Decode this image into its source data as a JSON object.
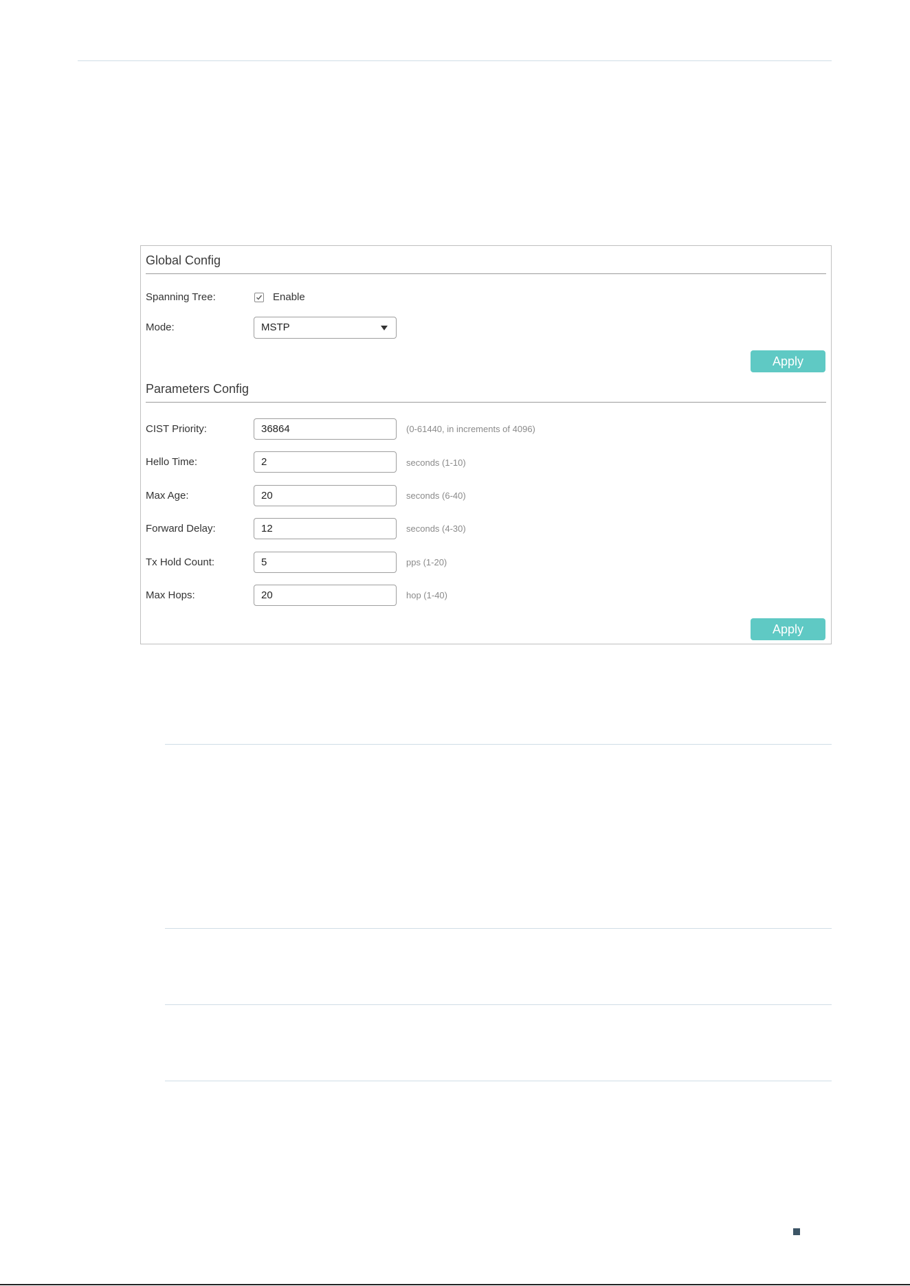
{
  "panel": {
    "global_config": {
      "title": "Global Config",
      "spanning_tree_label": "Spanning Tree:",
      "enable_label": "Enable",
      "enable_checked": true,
      "mode_label": "Mode:",
      "mode_value": "MSTP",
      "apply_label": "Apply"
    },
    "parameters_config": {
      "title": "Parameters Config",
      "rows": [
        {
          "label": "CIST Priority:",
          "value": "36864",
          "hint": "(0-61440, in increments of 4096)"
        },
        {
          "label": "Hello Time:",
          "value": "2",
          "hint": "seconds (1-10)"
        },
        {
          "label": "Max Age:",
          "value": "20",
          "hint": "seconds (6-40)"
        },
        {
          "label": "Forward Delay:",
          "value": "12",
          "hint": "seconds (4-30)"
        },
        {
          "label": "Tx Hold Count:",
          "value": "5",
          "hint": "pps (1-20)"
        },
        {
          "label": "Max Hops:",
          "value": "20",
          "hint": "hop (1-40)"
        }
      ],
      "apply_label": "Apply"
    }
  },
  "colors": {
    "accent": "#5fc9c4",
    "divider": "#cfdde6"
  }
}
